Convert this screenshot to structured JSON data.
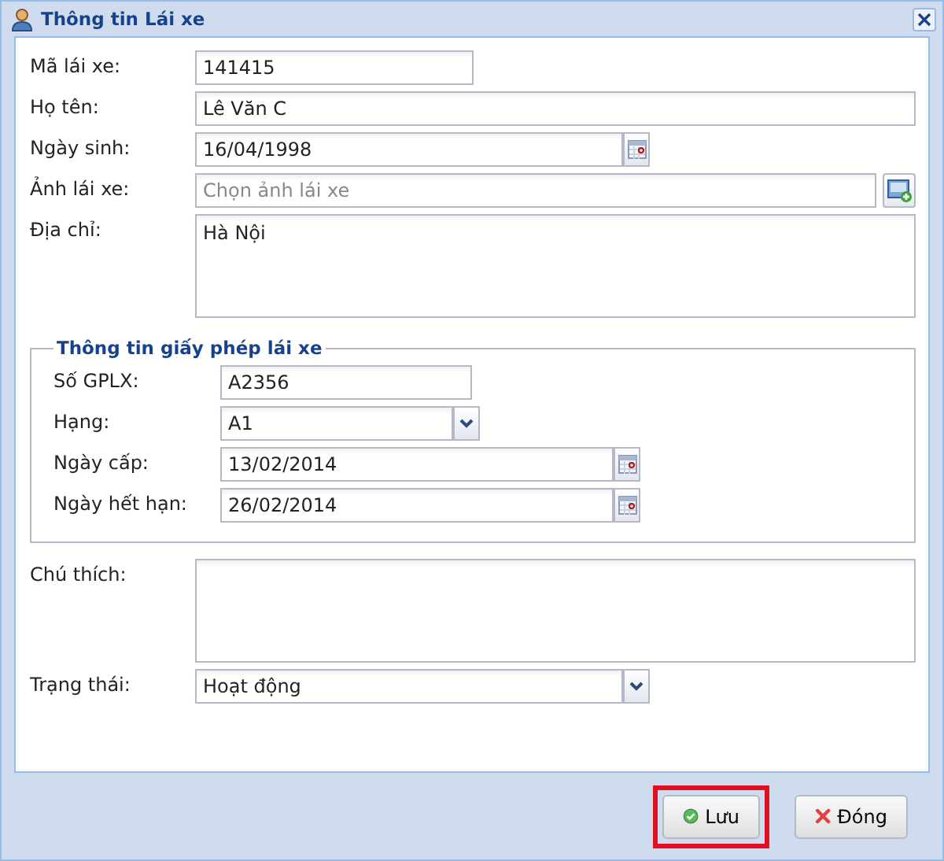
{
  "window": {
    "title": "Thông tin Lái xe"
  },
  "fields": [
    {
      "kind": "short_text",
      "label": "Mã lái xe:",
      "value": "141415"
    },
    {
      "kind": "text",
      "label": "Họ tên:",
      "value": "Lê Văn C"
    },
    {
      "kind": "date",
      "label": "Ngày sinh:",
      "value": "16/04/1998"
    },
    {
      "kind": "file",
      "label": "Ảnh lái xe:",
      "placeholder": "Chọn ảnh lái xe"
    },
    {
      "kind": "textarea",
      "label": "Địa chỉ:",
      "value": "Hà Nội"
    }
  ],
  "license": {
    "title": "Thông tin giấy phép lái xe",
    "fields": [
      {
        "kind": "short_text",
        "label": "Số GPLX:",
        "value": "A2356"
      },
      {
        "kind": "combo",
        "label": "Hạng:",
        "value": "A1"
      },
      {
        "kind": "date",
        "label": "Ngày cấp:",
        "value": "13/02/2014"
      },
      {
        "kind": "date",
        "label": "Ngày hết hạn:",
        "value": "26/02/2014"
      }
    ]
  },
  "extra_fields": [
    {
      "kind": "textarea",
      "label": "Chú thích:"
    },
    {
      "kind": "combo",
      "label": "Trạng thái:",
      "value": "Hoạt động"
    }
  ],
  "buttons": [
    {
      "kind": "save",
      "label": "Lưu",
      "highlighted": true
    },
    {
      "kind": "close",
      "label": "Đóng",
      "highlighted": false
    }
  ]
}
